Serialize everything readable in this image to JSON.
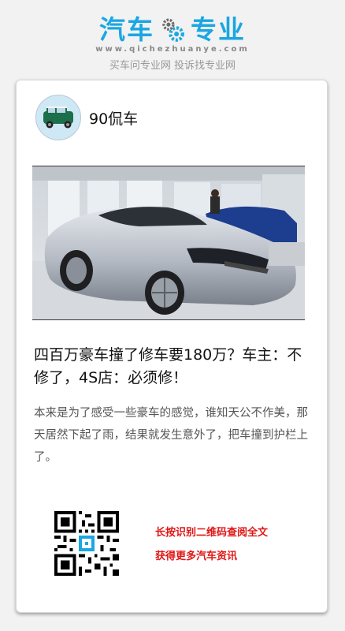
{
  "brand": {
    "logo_left": "汽车",
    "logo_right": "专业",
    "domain": "www.qichezhuanye.com",
    "slogan": "买车问专业网 投诉找专业网",
    "color": "#1aa7e3"
  },
  "article": {
    "author": "90侃车",
    "title": "四百万豪车撞了修车要180万？车主：不修了，4S店：必须修！",
    "summary": "本来是为了感受一些豪车的感觉，谁知天公不作美，那天居然下起了雨，结果就发生意外了，把车撞到护栏上了。"
  },
  "cta": {
    "line1": "长按识别二维码查阅全文",
    "line2": "获得更多汽车资讯",
    "color": "#e01515"
  },
  "icons": {
    "gear": "gear-icon",
    "avatar": "car-avatar-icon",
    "qr": "qr-code"
  }
}
